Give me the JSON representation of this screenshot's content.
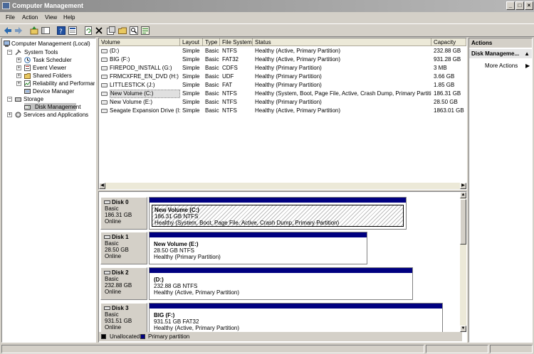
{
  "window": {
    "title": "Computer Management"
  },
  "menu": [
    "File",
    "Action",
    "View",
    "Help"
  ],
  "toolbar": [
    "back-icon",
    "forward-icon",
    "up-icon",
    "show-hide-tree-icon",
    "help-icon",
    "properties-panel-icon",
    "refresh-icon",
    "delete-icon",
    "properties-icon",
    "open-icon",
    "search-icon",
    "export-icon"
  ],
  "tree": {
    "root": "Computer Management (Local)",
    "system_tools": "System Tools",
    "task_scheduler": "Task Scheduler",
    "event_viewer": "Event Viewer",
    "shared_folders": "Shared Folders",
    "reliability": "Reliability and Performance",
    "device_manager": "Device Manager",
    "storage": "Storage",
    "disk_management": "Disk Management",
    "services": "Services and Applications"
  },
  "volume_table": {
    "columns": [
      "Volume",
      "Layout",
      "Type",
      "File System",
      "Status",
      "Capacity"
    ],
    "rows": [
      [
        "(D:)",
        "Simple",
        "Basic",
        "NTFS",
        "Healthy (Active, Primary Partition)",
        "232.88 GB"
      ],
      [
        "BIG (F:)",
        "Simple",
        "Basic",
        "FAT32",
        "Healthy (Active, Primary Partition)",
        "931.28 GB"
      ],
      [
        "FIREPOD_INSTALL (G:)",
        "Simple",
        "Basic",
        "CDFS",
        "Healthy (Primary Partition)",
        "3 MB"
      ],
      [
        "FRMCXFRE_EN_DVD (H:)",
        "Simple",
        "Basic",
        "UDF",
        "Healthy (Primary Partition)",
        "3.66 GB"
      ],
      [
        "LITTLESTICK (J:)",
        "Simple",
        "Basic",
        "FAT",
        "Healthy (Primary Partition)",
        "1.85 GB"
      ],
      [
        "New Volume (C:)",
        "Simple",
        "Basic",
        "NTFS",
        "Healthy (System, Boot, Page File, Active, Crash Dump, Primary Partition)",
        "186.31 GB"
      ],
      [
        "New Volume (E:)",
        "Simple",
        "Basic",
        "NTFS",
        "Healthy (Primary Partition)",
        "28.50 GB"
      ],
      [
        "Seagate Expansion Drive (I:)",
        "Simple",
        "Basic",
        "NTFS",
        "Healthy (Active, Primary Partition)",
        "1863.01 GB"
      ]
    ]
  },
  "disks": [
    {
      "name": "Disk 0",
      "type": "Basic",
      "size": "186.31 GB",
      "state": "Online",
      "part_name": "New Volume  (C:)",
      "part_size": "186.31 GB NTFS",
      "part_status": "Healthy (System, Boot, Page File, Active, Crash Dump, Primary Partition)"
    },
    {
      "name": "Disk 1",
      "type": "Basic",
      "size": "28.50 GB",
      "state": "Online",
      "part_name": "New Volume  (E:)",
      "part_size": "28.50 GB NTFS",
      "part_status": "Healthy (Primary Partition)"
    },
    {
      "name": "Disk 2",
      "type": "Basic",
      "size": "232.88 GB",
      "state": "Online",
      "part_name": "(D:)",
      "part_size": "232.88 GB NTFS",
      "part_status": "Healthy (Active, Primary Partition)"
    },
    {
      "name": "Disk 3",
      "type": "Basic",
      "size": "931.51 GB",
      "state": "Online",
      "part_name": "BIG  (F:)",
      "part_size": "931.51 GB FAT32",
      "part_status": "Healthy (Active, Primary Partition)"
    }
  ],
  "legend": {
    "unallocated": "Unallocated",
    "primary": "Primary partition",
    "unallocated_color": "#000000",
    "primary_color": "#000080"
  },
  "actions": {
    "header": "Actions",
    "section": "Disk Manageme...",
    "more": "More Actions"
  }
}
